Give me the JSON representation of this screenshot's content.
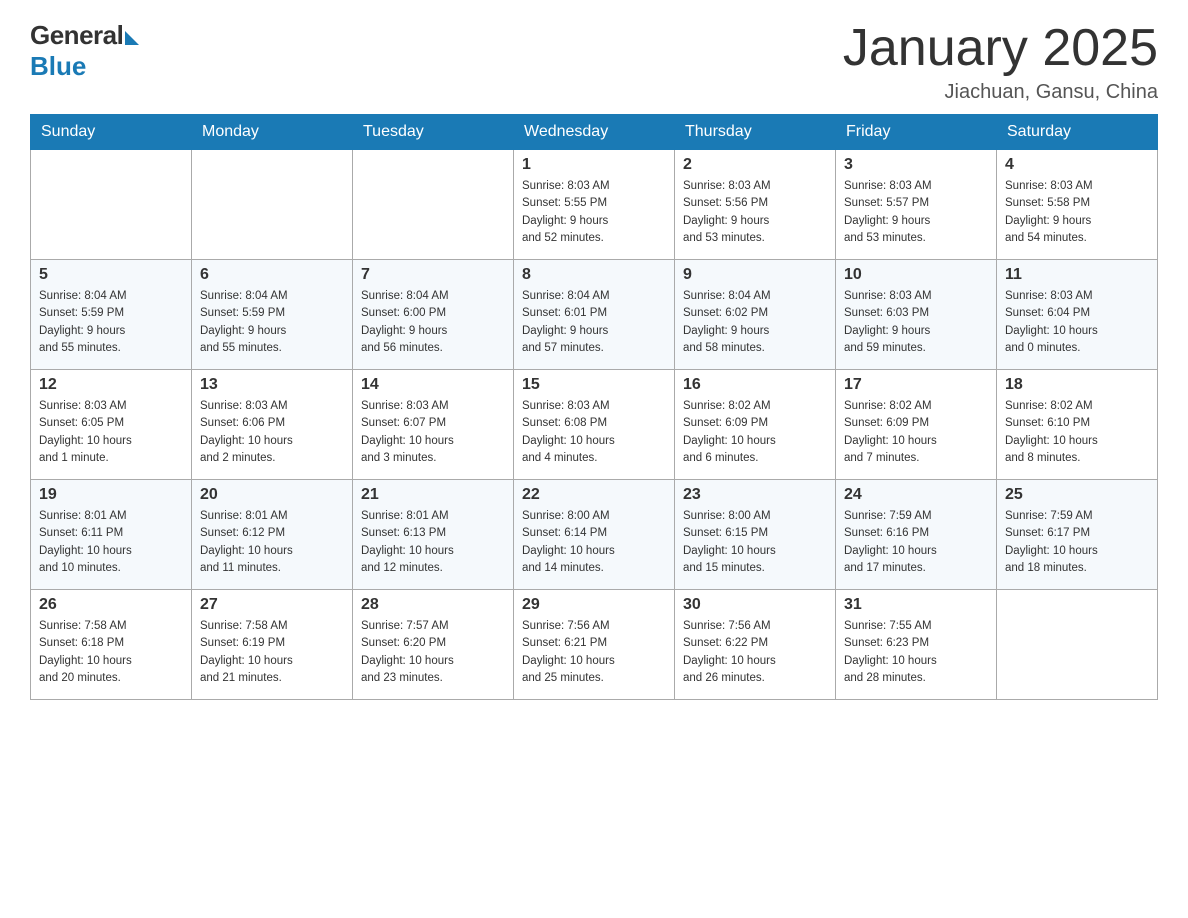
{
  "logo": {
    "general": "General",
    "blue": "Blue"
  },
  "title": "January 2025",
  "location": "Jiachuan, Gansu, China",
  "days_of_week": [
    "Sunday",
    "Monday",
    "Tuesday",
    "Wednesday",
    "Thursday",
    "Friday",
    "Saturday"
  ],
  "weeks": [
    [
      {
        "day": "",
        "info": ""
      },
      {
        "day": "",
        "info": ""
      },
      {
        "day": "",
        "info": ""
      },
      {
        "day": "1",
        "info": "Sunrise: 8:03 AM\nSunset: 5:55 PM\nDaylight: 9 hours\nand 52 minutes."
      },
      {
        "day": "2",
        "info": "Sunrise: 8:03 AM\nSunset: 5:56 PM\nDaylight: 9 hours\nand 53 minutes."
      },
      {
        "day": "3",
        "info": "Sunrise: 8:03 AM\nSunset: 5:57 PM\nDaylight: 9 hours\nand 53 minutes."
      },
      {
        "day": "4",
        "info": "Sunrise: 8:03 AM\nSunset: 5:58 PM\nDaylight: 9 hours\nand 54 minutes."
      }
    ],
    [
      {
        "day": "5",
        "info": "Sunrise: 8:04 AM\nSunset: 5:59 PM\nDaylight: 9 hours\nand 55 minutes."
      },
      {
        "day": "6",
        "info": "Sunrise: 8:04 AM\nSunset: 5:59 PM\nDaylight: 9 hours\nand 55 minutes."
      },
      {
        "day": "7",
        "info": "Sunrise: 8:04 AM\nSunset: 6:00 PM\nDaylight: 9 hours\nand 56 minutes."
      },
      {
        "day": "8",
        "info": "Sunrise: 8:04 AM\nSunset: 6:01 PM\nDaylight: 9 hours\nand 57 minutes."
      },
      {
        "day": "9",
        "info": "Sunrise: 8:04 AM\nSunset: 6:02 PM\nDaylight: 9 hours\nand 58 minutes."
      },
      {
        "day": "10",
        "info": "Sunrise: 8:03 AM\nSunset: 6:03 PM\nDaylight: 9 hours\nand 59 minutes."
      },
      {
        "day": "11",
        "info": "Sunrise: 8:03 AM\nSunset: 6:04 PM\nDaylight: 10 hours\nand 0 minutes."
      }
    ],
    [
      {
        "day": "12",
        "info": "Sunrise: 8:03 AM\nSunset: 6:05 PM\nDaylight: 10 hours\nand 1 minute."
      },
      {
        "day": "13",
        "info": "Sunrise: 8:03 AM\nSunset: 6:06 PM\nDaylight: 10 hours\nand 2 minutes."
      },
      {
        "day": "14",
        "info": "Sunrise: 8:03 AM\nSunset: 6:07 PM\nDaylight: 10 hours\nand 3 minutes."
      },
      {
        "day": "15",
        "info": "Sunrise: 8:03 AM\nSunset: 6:08 PM\nDaylight: 10 hours\nand 4 minutes."
      },
      {
        "day": "16",
        "info": "Sunrise: 8:02 AM\nSunset: 6:09 PM\nDaylight: 10 hours\nand 6 minutes."
      },
      {
        "day": "17",
        "info": "Sunrise: 8:02 AM\nSunset: 6:09 PM\nDaylight: 10 hours\nand 7 minutes."
      },
      {
        "day": "18",
        "info": "Sunrise: 8:02 AM\nSunset: 6:10 PM\nDaylight: 10 hours\nand 8 minutes."
      }
    ],
    [
      {
        "day": "19",
        "info": "Sunrise: 8:01 AM\nSunset: 6:11 PM\nDaylight: 10 hours\nand 10 minutes."
      },
      {
        "day": "20",
        "info": "Sunrise: 8:01 AM\nSunset: 6:12 PM\nDaylight: 10 hours\nand 11 minutes."
      },
      {
        "day": "21",
        "info": "Sunrise: 8:01 AM\nSunset: 6:13 PM\nDaylight: 10 hours\nand 12 minutes."
      },
      {
        "day": "22",
        "info": "Sunrise: 8:00 AM\nSunset: 6:14 PM\nDaylight: 10 hours\nand 14 minutes."
      },
      {
        "day": "23",
        "info": "Sunrise: 8:00 AM\nSunset: 6:15 PM\nDaylight: 10 hours\nand 15 minutes."
      },
      {
        "day": "24",
        "info": "Sunrise: 7:59 AM\nSunset: 6:16 PM\nDaylight: 10 hours\nand 17 minutes."
      },
      {
        "day": "25",
        "info": "Sunrise: 7:59 AM\nSunset: 6:17 PM\nDaylight: 10 hours\nand 18 minutes."
      }
    ],
    [
      {
        "day": "26",
        "info": "Sunrise: 7:58 AM\nSunset: 6:18 PM\nDaylight: 10 hours\nand 20 minutes."
      },
      {
        "day": "27",
        "info": "Sunrise: 7:58 AM\nSunset: 6:19 PM\nDaylight: 10 hours\nand 21 minutes."
      },
      {
        "day": "28",
        "info": "Sunrise: 7:57 AM\nSunset: 6:20 PM\nDaylight: 10 hours\nand 23 minutes."
      },
      {
        "day": "29",
        "info": "Sunrise: 7:56 AM\nSunset: 6:21 PM\nDaylight: 10 hours\nand 25 minutes."
      },
      {
        "day": "30",
        "info": "Sunrise: 7:56 AM\nSunset: 6:22 PM\nDaylight: 10 hours\nand 26 minutes."
      },
      {
        "day": "31",
        "info": "Sunrise: 7:55 AM\nSunset: 6:23 PM\nDaylight: 10 hours\nand 28 minutes."
      },
      {
        "day": "",
        "info": ""
      }
    ]
  ]
}
